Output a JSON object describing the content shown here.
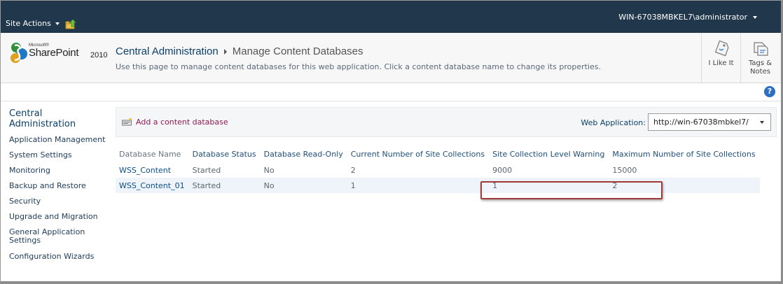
{
  "topbar": {
    "site_actions_label": "Site Actions",
    "user_label": "WIN-67038MBKEL7\\administrator"
  },
  "logo": {
    "microsoft": "Microsoft®",
    "product": "SharePoint",
    "year": "2010"
  },
  "header": {
    "breadcrumb_root": "Central Administration",
    "page_title": "Manage Content Databases",
    "description": "Use this page to manage content databases for this web application. Click a content database name to change its properties."
  },
  "social": {
    "like_label": "I Like It",
    "tags_label_line1": "Tags &",
    "tags_label_line2": "Notes"
  },
  "help": {
    "icon_glyph": "?"
  },
  "leftnav": {
    "heading": "Central Administration",
    "items": [
      "Application Management",
      "System Settings",
      "Monitoring",
      "Backup and Restore",
      "Security",
      "Upgrade and Migration",
      "General Application Settings",
      "Configuration Wizards"
    ]
  },
  "toolbar": {
    "add_database_label": "Add a content database",
    "web_application_label": "Web Application:",
    "web_application_value": "http://win-67038mbkel7/"
  },
  "table": {
    "columns": [
      "Database Name",
      "Database Status",
      "Database Read-Only",
      "Current Number of Site Collections",
      "Site Collection Level Warning",
      "Maximum Number of Site Collections"
    ],
    "rows": [
      [
        "WSS_Content",
        "Started",
        "No",
        "2",
        "9000",
        "15000"
      ],
      [
        "WSS_Content_01",
        "Started",
        "No",
        "1",
        "1",
        "2"
      ]
    ]
  },
  "colors": {
    "topbar_bg": "#21374c",
    "highlight_border": "#a33a3a",
    "link_blue": "#0b4f8a",
    "add_link": "#8c1a55"
  }
}
